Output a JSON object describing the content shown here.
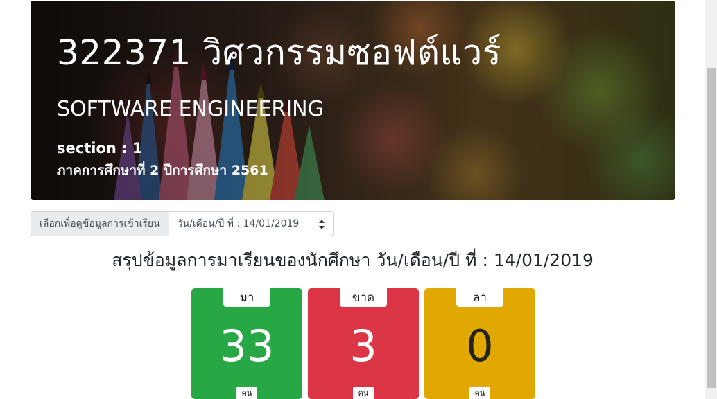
{
  "hero": {
    "title": "322371 วิศวกรรมซอฟต์แวร์",
    "subtitle": "SOFTWARE ENGINEERING",
    "section": "section : 1",
    "term": "ภาคการศึกษาที่ 2 ปีการศึกษา 2561"
  },
  "selector": {
    "label": "เลือกเพื่อดูข้อมูลการเข้าเรียน",
    "selected": "วัน/เดือน/ปี ที่ : 14/01/2019"
  },
  "summary": {
    "title": "สรุปข้อมูลการมาเรียนของนักศึกษา วัน/เดือน/ปี ที่ : 14/01/2019"
  },
  "cards": [
    {
      "label": "มา",
      "value": "33",
      "unit": "คน",
      "color": "#28a745"
    },
    {
      "label": "ขาด",
      "value": "3",
      "unit": "คน",
      "color": "#dc3545"
    },
    {
      "label": "ลา",
      "value": "0",
      "unit": "คน",
      "color": "#e0a800"
    }
  ]
}
